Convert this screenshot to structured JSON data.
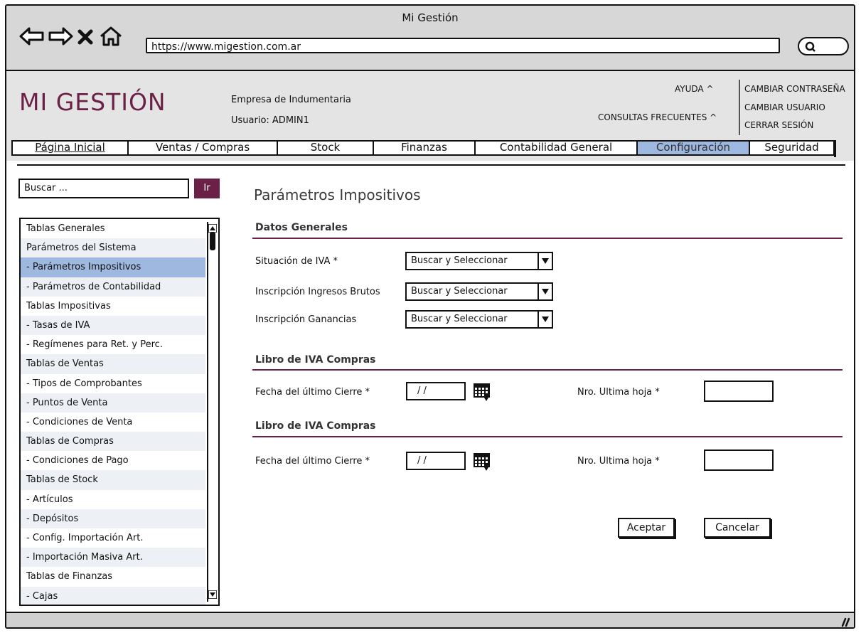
{
  "window": {
    "title": "Mi Gestión"
  },
  "browser": {
    "url": "https://www.migestion.com.ar"
  },
  "header": {
    "app_name": "MI GESTIÓN",
    "company": "Empresa de Indumentaria",
    "user": "Usuario: ADMIN1",
    "help_link": "AYUDA ^",
    "faq_link": "CONSULTAS FRECUENTES ^",
    "change_password": "CAMBIAR CONTRASEÑA",
    "change_user": "CAMBIAR USUARIO",
    "logout": "CERRAR SESIÓN"
  },
  "menu": {
    "items": [
      {
        "label": "Página Inicial"
      },
      {
        "label": "Ventas / Compras"
      },
      {
        "label": "Stock"
      },
      {
        "label": "Finanzas"
      },
      {
        "label": "Contabilidad General"
      },
      {
        "label": "Configuración",
        "active": true
      },
      {
        "label": "Seguridad"
      }
    ]
  },
  "sidebar": {
    "search_placeholder": "Buscar ...",
    "go_label": "Ir",
    "items": [
      {
        "label": "Tablas Generales"
      },
      {
        "label": "Parámetros del Sistema"
      },
      {
        "label": "- Parámetros Impositivos",
        "selected": true
      },
      {
        "label": "- Parámetros de Contabilidad"
      },
      {
        "label": "Tablas Impositivas"
      },
      {
        "label": "- Tasas de IVA"
      },
      {
        "label": "- Regímenes para Ret. y Perc."
      },
      {
        "label": "Tablas de Ventas"
      },
      {
        "label": "- Tipos de Comprobantes"
      },
      {
        "label": "- Puntos de Venta"
      },
      {
        "label": "- Condiciones de Venta"
      },
      {
        "label": "Tablas de Compras"
      },
      {
        "label": "- Condiciones de Pago"
      },
      {
        "label": "Tablas de Stock"
      },
      {
        "label": "- Artículos"
      },
      {
        "label": "- Depósitos"
      },
      {
        "label": "- Config. Importación Art."
      },
      {
        "label": "- Importación Masiva Art."
      },
      {
        "label": "Tablas de Finanzas"
      },
      {
        "label": "- Cajas"
      }
    ]
  },
  "main": {
    "title": "Parámetros Impositivos",
    "section_general": {
      "title": "Datos Generales",
      "fields": [
        {
          "label": "Situación de IVA *",
          "value": "Buscar y Seleccionar"
        },
        {
          "label": "Inscripción Ingresos Brutos",
          "value": "Buscar y Seleccionar"
        },
        {
          "label": "Inscripción Ganancias",
          "value": "Buscar y Seleccionar"
        }
      ]
    },
    "section_book1": {
      "title": "Libro de IVA Compras",
      "date_label": "Fecha del último Cierre *",
      "date_value": "/ /",
      "page_label": "Nro. Ultima hoja *",
      "page_value": ""
    },
    "section_book2": {
      "title": "Libro de IVA Compras",
      "date_label": "Fecha del último Cierre *",
      "date_value": "/ /",
      "page_label": "Nro. Ultima hoja *",
      "page_value": ""
    },
    "accept_label": "Aceptar",
    "cancel_label": "Cancelar"
  },
  "colors": {
    "brand": "#6b2147",
    "selection": "#9fb8e0",
    "chrome": "#d7d7d7",
    "header": "#e4e4e4"
  }
}
